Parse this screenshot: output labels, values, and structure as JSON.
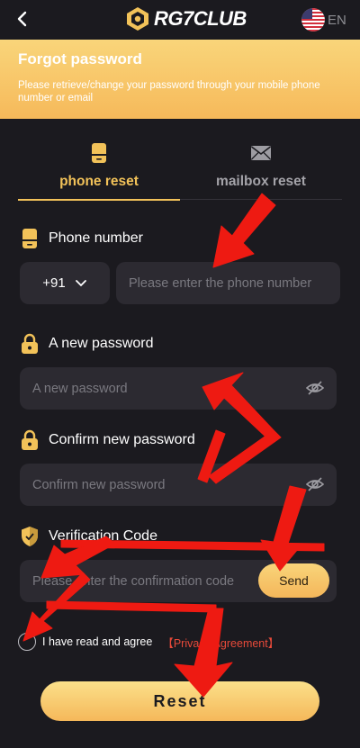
{
  "header": {
    "logo_text": "RG7CLUB",
    "language": "EN"
  },
  "banner": {
    "title": "Forgot password",
    "description": "Please retrieve/change your password through your mobile phone number or email"
  },
  "tabs": [
    {
      "label": "phone reset",
      "icon": "phone-icon",
      "active": true
    },
    {
      "label": "mailbox reset",
      "icon": "mail-icon",
      "active": false
    }
  ],
  "form": {
    "phone_label": "Phone number",
    "country_code": "+91",
    "phone_placeholder": "Please enter the phone number",
    "new_password_label": "A new password",
    "new_password_placeholder": "A new password",
    "confirm_password_label": "Confirm new password",
    "confirm_password_placeholder": "Confirm new password",
    "code_label": "Verification Code",
    "code_placeholder": "Please enter the confirmation code",
    "send_label": "Send",
    "agree_text": "I have read and agree",
    "agreement_link": "【Privacy Agreement】",
    "reset_label": "Reset"
  },
  "colors": {
    "accent": "#f2c259",
    "background": "#1b1a1f",
    "input_bg": "#2c2a31",
    "link_red": "#e84a3a",
    "annotation_arrow": "#ee1a12"
  }
}
